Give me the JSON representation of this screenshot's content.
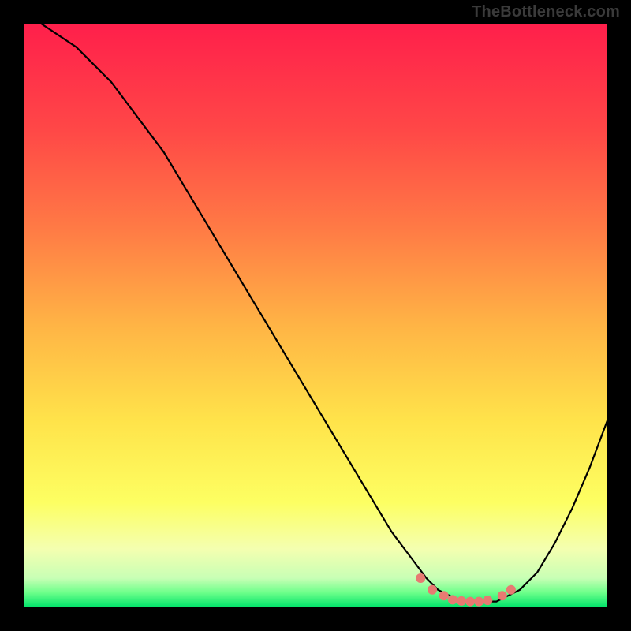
{
  "watermark": "TheBottleneck.com",
  "chart_data": {
    "type": "line",
    "title": "",
    "xlabel": "",
    "ylabel": "",
    "xlim": [
      0,
      100
    ],
    "ylim": [
      0,
      100
    ],
    "grid": false,
    "background": "rainbow-gradient",
    "series": [
      {
        "name": "curve",
        "x": [
          3,
          6,
          9,
          12,
          15,
          18,
          21,
          24,
          27,
          30,
          33,
          36,
          39,
          42,
          45,
          48,
          51,
          54,
          57,
          60,
          63,
          66,
          69,
          71,
          73,
          75,
          77,
          79,
          81,
          83,
          85,
          88,
          91,
          94,
          97,
          100
        ],
        "values": [
          100,
          98,
          96,
          93,
          90,
          86,
          82,
          78,
          73,
          68,
          63,
          58,
          53,
          48,
          43,
          38,
          33,
          28,
          23,
          18,
          13,
          9,
          5,
          3,
          2,
          1,
          1,
          1,
          1,
          2,
          3,
          6,
          11,
          17,
          24,
          32
        ]
      }
    ],
    "markers": {
      "name": "highlight-dots",
      "color": "#e77a72",
      "x": [
        68,
        70,
        72,
        73.5,
        75,
        76.5,
        78,
        79.5,
        82,
        83.5
      ],
      "values": [
        5,
        3,
        2,
        1.3,
        1.1,
        1.0,
        1.0,
        1.2,
        2.0,
        3.0
      ]
    },
    "gradient_stops": [
      {
        "offset": 0.0,
        "color": "#ff1f4b"
      },
      {
        "offset": 0.18,
        "color": "#ff4747"
      },
      {
        "offset": 0.35,
        "color": "#ff7a45"
      },
      {
        "offset": 0.52,
        "color": "#ffb545"
      },
      {
        "offset": 0.68,
        "color": "#ffe34a"
      },
      {
        "offset": 0.82,
        "color": "#fdff62"
      },
      {
        "offset": 0.9,
        "color": "#f4ffb0"
      },
      {
        "offset": 0.95,
        "color": "#c8ffb5"
      },
      {
        "offset": 0.975,
        "color": "#6cff8a"
      },
      {
        "offset": 1.0,
        "color": "#00e36a"
      }
    ]
  }
}
